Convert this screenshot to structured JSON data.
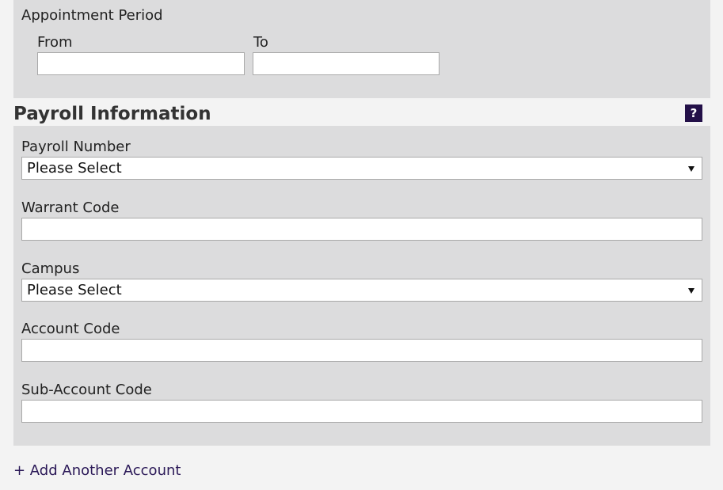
{
  "appointment": {
    "title": "Appointment Period",
    "from_label": "From",
    "from_value": "",
    "to_label": "To",
    "to_value": ""
  },
  "payroll": {
    "title": "Payroll Information",
    "help_glyph": "?",
    "payroll_number": {
      "label": "Payroll Number",
      "selected": "Please Select"
    },
    "warrant_code": {
      "label": "Warrant Code",
      "value": ""
    },
    "campus": {
      "label": "Campus",
      "selected": "Please Select"
    },
    "account_code": {
      "label": "Account Code",
      "value": ""
    },
    "sub_account_code": {
      "label": "Sub-Account Code",
      "value": ""
    }
  },
  "actions": {
    "add_account": "+ Add Another Account"
  },
  "colors": {
    "page_background": "#f3f3f3",
    "panel_background": "#dcdcdd",
    "accent": "#231048",
    "link": "#2a1857"
  }
}
